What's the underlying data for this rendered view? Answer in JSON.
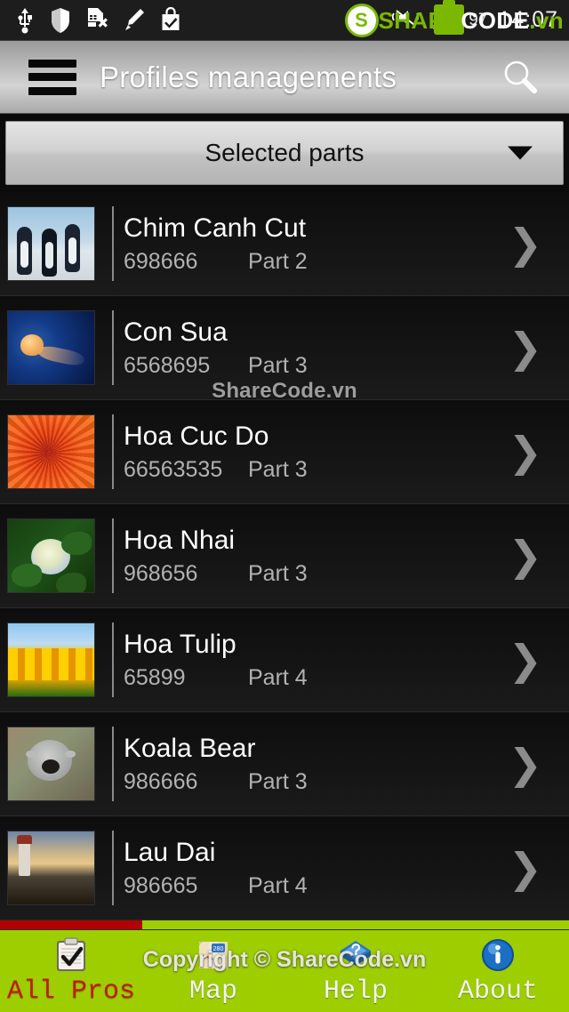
{
  "status_bar": {
    "left_icons": [
      "usb-icon",
      "shield-icon",
      "sim-card-error-icon",
      "pencil-icon",
      "shopping-bag-check-icon"
    ],
    "right_icons": [
      "bluetooth-icon",
      "mute-vibrate-icon",
      "signal-bars-icon"
    ],
    "battery_percent": "97",
    "clock": "14:07",
    "watermark": {
      "badge": "S",
      "text_green": "SHARE",
      "text_white": "CODE",
      "text_green2": ".vn"
    }
  },
  "action_bar": {
    "title": "Profiles managements",
    "menu_icon": "hamburger-menu-icon",
    "search_icon": "search-icon"
  },
  "spinner": {
    "selected": "Selected parts",
    "arrow_icon": "chevron-down-icon"
  },
  "list": {
    "watermark": "ShareCode.vn",
    "chevron_glyph": "❯",
    "rows": [
      {
        "title": "Chim Canh Cut",
        "id": "698666",
        "part": "Part 2",
        "thumb": "t-penguin",
        "thumb_name": "penguins-thumbnail"
      },
      {
        "title": "Con Sua",
        "id": "6568695",
        "part": "Part 3",
        "thumb": "t-jelly",
        "thumb_name": "jellyfish-thumbnail"
      },
      {
        "title": "Hoa Cuc Do",
        "id": "66563535",
        "part": "Part 3",
        "thumb": "t-chrys",
        "thumb_name": "red-chrysanthemum-thumbnail"
      },
      {
        "title": "Hoa Nhai",
        "id": "968656",
        "part": "Part 3",
        "thumb": "t-hydr",
        "thumb_name": "hydrangea-thumbnail"
      },
      {
        "title": "Hoa Tulip",
        "id": "65899",
        "part": "Part 4",
        "thumb": "t-tulip",
        "thumb_name": "yellow-tulips-thumbnail"
      },
      {
        "title": "Koala Bear",
        "id": "986666",
        "part": "Part 3",
        "thumb": "t-koala",
        "thumb_name": "koala-thumbnail"
      },
      {
        "title": "Lau Dai",
        "id": "986665",
        "part": "Part 4",
        "thumb": "t-light",
        "thumb_name": "lighthouse-thumbnail"
      }
    ]
  },
  "bottom_nav": {
    "watermark": "Copyright © ShareCode.vn",
    "active_index": 0,
    "tabs": [
      {
        "label": "All Pros",
        "icon": "clipboard-check-icon",
        "active": true
      },
      {
        "label": "Map",
        "icon": "folded-map-icon",
        "active": false
      },
      {
        "label": "Help",
        "icon": "help-book-icon",
        "active": false
      },
      {
        "label": "About",
        "icon": "info-circle-icon",
        "active": false
      }
    ]
  },
  "colors": {
    "nav_green": "#9ecd00",
    "active_red": "#c41a08",
    "indicator_red": "#b00000",
    "list_bg": "#101010",
    "title_white": "#ffffff",
    "subtitle_gray": "#b2b2b2"
  }
}
